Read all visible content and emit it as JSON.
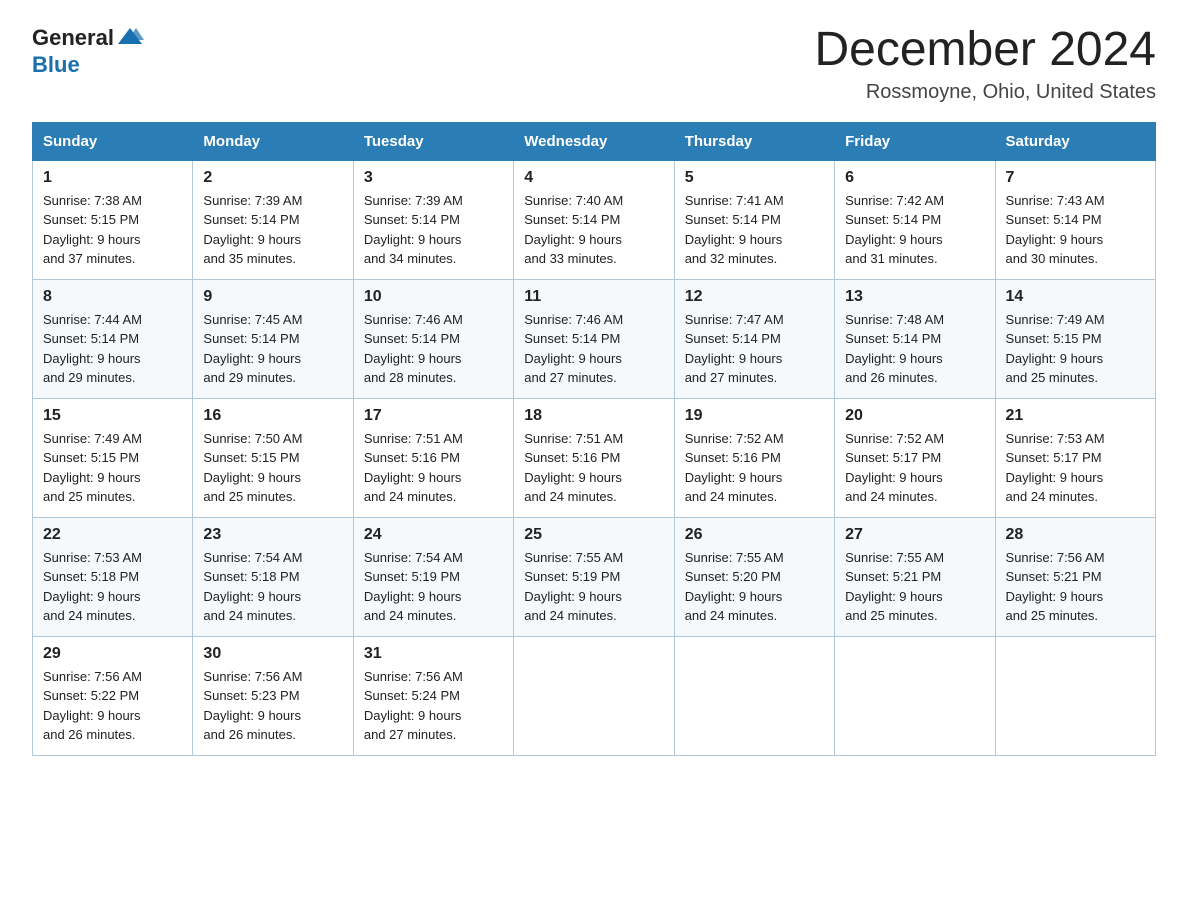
{
  "header": {
    "title": "December 2024",
    "subtitle": "Rossmoyne, Ohio, United States",
    "logo_general": "General",
    "logo_blue": "Blue"
  },
  "days_of_week": [
    "Sunday",
    "Monday",
    "Tuesday",
    "Wednesday",
    "Thursday",
    "Friday",
    "Saturday"
  ],
  "weeks": [
    [
      {
        "day": "1",
        "sunrise": "7:38 AM",
        "sunset": "5:15 PM",
        "daylight": "9 hours and 37 minutes."
      },
      {
        "day": "2",
        "sunrise": "7:39 AM",
        "sunset": "5:14 PM",
        "daylight": "9 hours and 35 minutes."
      },
      {
        "day": "3",
        "sunrise": "7:39 AM",
        "sunset": "5:14 PM",
        "daylight": "9 hours and 34 minutes."
      },
      {
        "day": "4",
        "sunrise": "7:40 AM",
        "sunset": "5:14 PM",
        "daylight": "9 hours and 33 minutes."
      },
      {
        "day": "5",
        "sunrise": "7:41 AM",
        "sunset": "5:14 PM",
        "daylight": "9 hours and 32 minutes."
      },
      {
        "day": "6",
        "sunrise": "7:42 AM",
        "sunset": "5:14 PM",
        "daylight": "9 hours and 31 minutes."
      },
      {
        "day": "7",
        "sunrise": "7:43 AM",
        "sunset": "5:14 PM",
        "daylight": "9 hours and 30 minutes."
      }
    ],
    [
      {
        "day": "8",
        "sunrise": "7:44 AM",
        "sunset": "5:14 PM",
        "daylight": "9 hours and 29 minutes."
      },
      {
        "day": "9",
        "sunrise": "7:45 AM",
        "sunset": "5:14 PM",
        "daylight": "9 hours and 29 minutes."
      },
      {
        "day": "10",
        "sunrise": "7:46 AM",
        "sunset": "5:14 PM",
        "daylight": "9 hours and 28 minutes."
      },
      {
        "day": "11",
        "sunrise": "7:46 AM",
        "sunset": "5:14 PM",
        "daylight": "9 hours and 27 minutes."
      },
      {
        "day": "12",
        "sunrise": "7:47 AM",
        "sunset": "5:14 PM",
        "daylight": "9 hours and 27 minutes."
      },
      {
        "day": "13",
        "sunrise": "7:48 AM",
        "sunset": "5:14 PM",
        "daylight": "9 hours and 26 minutes."
      },
      {
        "day": "14",
        "sunrise": "7:49 AM",
        "sunset": "5:15 PM",
        "daylight": "9 hours and 25 minutes."
      }
    ],
    [
      {
        "day": "15",
        "sunrise": "7:49 AM",
        "sunset": "5:15 PM",
        "daylight": "9 hours and 25 minutes."
      },
      {
        "day": "16",
        "sunrise": "7:50 AM",
        "sunset": "5:15 PM",
        "daylight": "9 hours and 25 minutes."
      },
      {
        "day": "17",
        "sunrise": "7:51 AM",
        "sunset": "5:16 PM",
        "daylight": "9 hours and 24 minutes."
      },
      {
        "day": "18",
        "sunrise": "7:51 AM",
        "sunset": "5:16 PM",
        "daylight": "9 hours and 24 minutes."
      },
      {
        "day": "19",
        "sunrise": "7:52 AM",
        "sunset": "5:16 PM",
        "daylight": "9 hours and 24 minutes."
      },
      {
        "day": "20",
        "sunrise": "7:52 AM",
        "sunset": "5:17 PM",
        "daylight": "9 hours and 24 minutes."
      },
      {
        "day": "21",
        "sunrise": "7:53 AM",
        "sunset": "5:17 PM",
        "daylight": "9 hours and 24 minutes."
      }
    ],
    [
      {
        "day": "22",
        "sunrise": "7:53 AM",
        "sunset": "5:18 PM",
        "daylight": "9 hours and 24 minutes."
      },
      {
        "day": "23",
        "sunrise": "7:54 AM",
        "sunset": "5:18 PM",
        "daylight": "9 hours and 24 minutes."
      },
      {
        "day": "24",
        "sunrise": "7:54 AM",
        "sunset": "5:19 PM",
        "daylight": "9 hours and 24 minutes."
      },
      {
        "day": "25",
        "sunrise": "7:55 AM",
        "sunset": "5:19 PM",
        "daylight": "9 hours and 24 minutes."
      },
      {
        "day": "26",
        "sunrise": "7:55 AM",
        "sunset": "5:20 PM",
        "daylight": "9 hours and 24 minutes."
      },
      {
        "day": "27",
        "sunrise": "7:55 AM",
        "sunset": "5:21 PM",
        "daylight": "9 hours and 25 minutes."
      },
      {
        "day": "28",
        "sunrise": "7:56 AM",
        "sunset": "5:21 PM",
        "daylight": "9 hours and 25 minutes."
      }
    ],
    [
      {
        "day": "29",
        "sunrise": "7:56 AM",
        "sunset": "5:22 PM",
        "daylight": "9 hours and 26 minutes."
      },
      {
        "day": "30",
        "sunrise": "7:56 AM",
        "sunset": "5:23 PM",
        "daylight": "9 hours and 26 minutes."
      },
      {
        "day": "31",
        "sunrise": "7:56 AM",
        "sunset": "5:24 PM",
        "daylight": "9 hours and 27 minutes."
      },
      null,
      null,
      null,
      null
    ]
  ],
  "labels": {
    "sunrise": "Sunrise:",
    "sunset": "Sunset:",
    "daylight": "Daylight:"
  }
}
